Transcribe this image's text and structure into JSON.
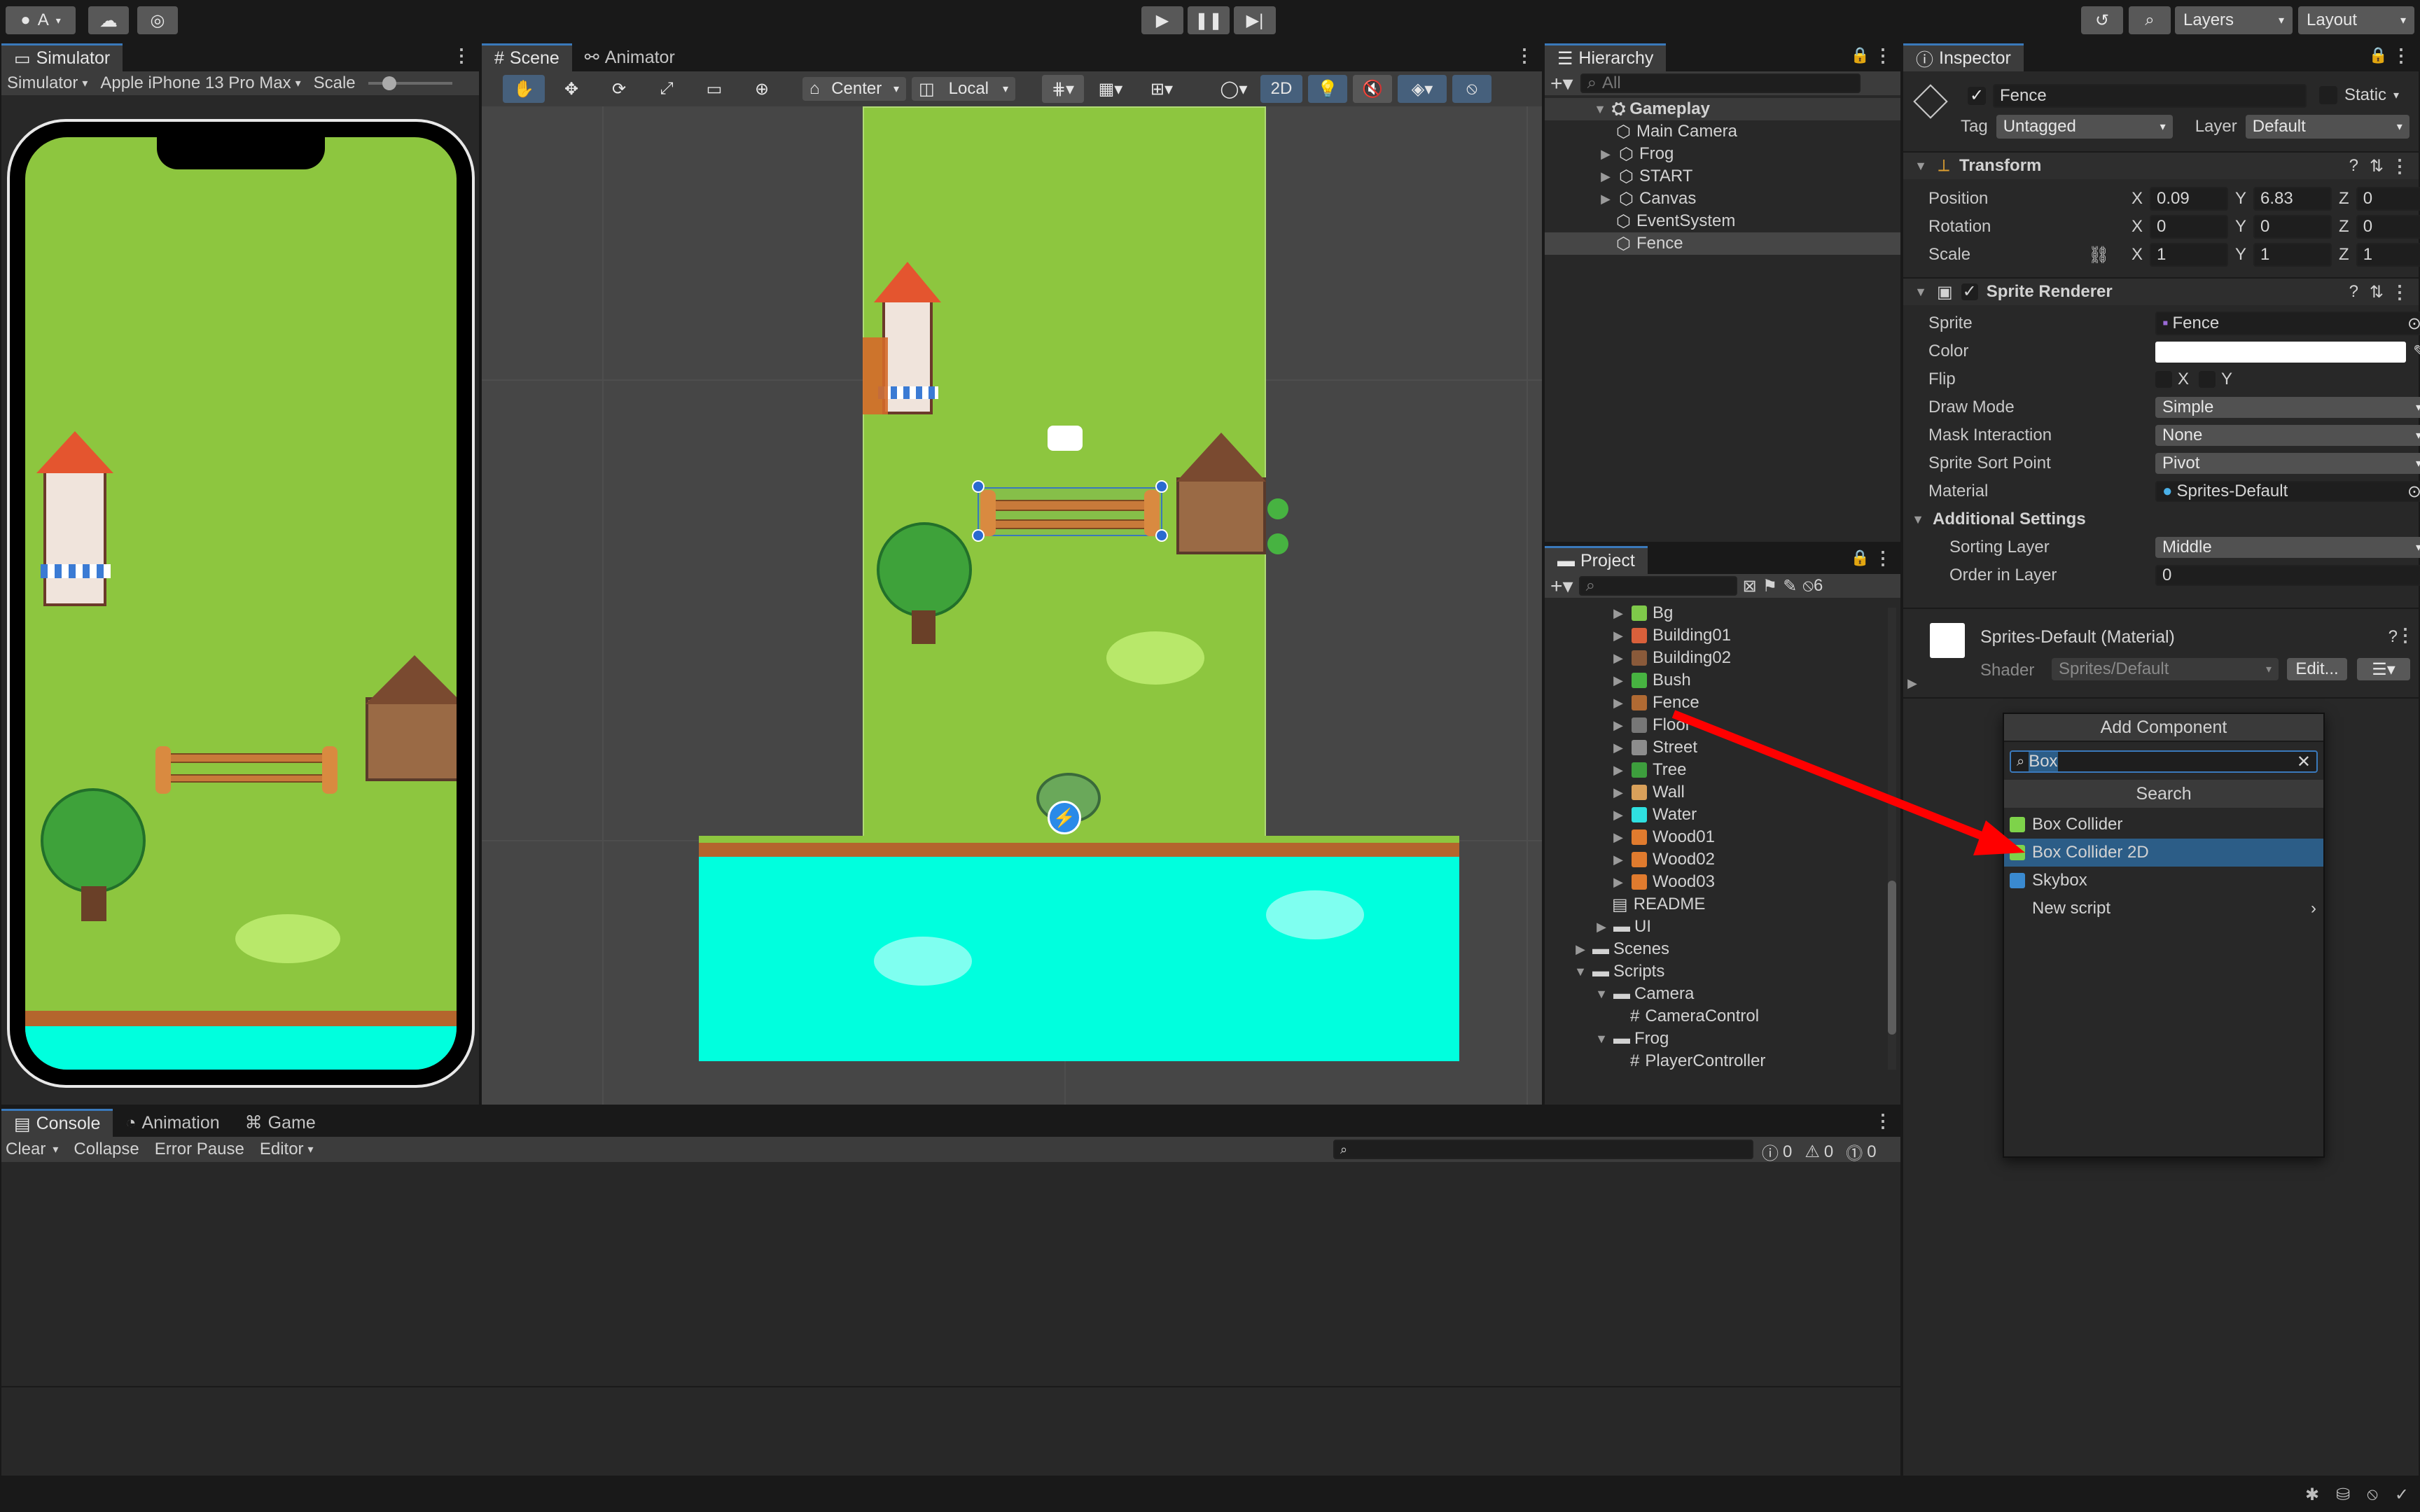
{
  "toolbar": {
    "account": "A",
    "layers": "Layers",
    "layout": "Layout"
  },
  "simulator": {
    "tab": "Simulator",
    "mode": "Simulator",
    "device": "Apple iPhone 13 Pro Max",
    "scale_label": "Scale"
  },
  "scene": {
    "tab_scene": "Scene",
    "tab_animator": "Animator",
    "pivot": "Center",
    "space": "Local",
    "mode_2d": "2D"
  },
  "hierarchy": {
    "tab": "Hierarchy",
    "search_placeholder": "All",
    "root": "Gameplay",
    "items": [
      "Main Camera",
      "Frog",
      "START",
      "Canvas",
      "EventSystem",
      "Fence"
    ]
  },
  "project": {
    "tab": "Project",
    "hidden_count": "6",
    "items": [
      {
        "label": "Bg",
        "color": "#7fc94a"
      },
      {
        "label": "Building01",
        "color": "#d9603b"
      },
      {
        "label": "Building02",
        "color": "#8a5a3a"
      },
      {
        "label": "Bush",
        "color": "#47b341"
      },
      {
        "label": "Fence",
        "color": "#b06a33"
      },
      {
        "label": "Floor",
        "color": "#777777"
      },
      {
        "label": "Street",
        "color": "#8d8d8d"
      },
      {
        "label": "Tree",
        "color": "#3d9e3d"
      },
      {
        "label": "Wall",
        "color": "#d9a05a"
      },
      {
        "label": "Water",
        "color": "#2fe0e0"
      },
      {
        "label": "Wood01",
        "color": "#e07b2e"
      },
      {
        "label": "Wood02",
        "color": "#e07b2e"
      },
      {
        "label": "Wood03",
        "color": "#e07b2e"
      }
    ],
    "readme": "README",
    "ui": "UI",
    "scenes": "Scenes",
    "scripts": "Scripts",
    "camera": "Camera",
    "camera_control": "CameraControl",
    "frog": "Frog",
    "player_controller": "PlayerController"
  },
  "inspector": {
    "tab": "Inspector",
    "object_name": "Fence",
    "static": "Static",
    "tag_label": "Tag",
    "tag_value": "Untagged",
    "layer_label": "Layer",
    "layer_value": "Default",
    "transform": {
      "title": "Transform",
      "position": "Position",
      "rotation": "Rotation",
      "scale": "Scale",
      "pos": {
        "x": "0.09",
        "y": "6.83",
        "z": "0"
      },
      "rot": {
        "x": "0",
        "y": "0",
        "z": "0"
      },
      "scl": {
        "x": "1",
        "y": "1",
        "z": "1"
      }
    },
    "sprite_renderer": {
      "title": "Sprite Renderer",
      "sprite": "Sprite",
      "sprite_value": "Fence",
      "color": "Color",
      "flip": "Flip",
      "draw_mode": "Draw Mode",
      "draw_mode_value": "Simple",
      "mask": "Mask Interaction",
      "mask_value": "None",
      "sort_point": "Sprite Sort Point",
      "sort_point_value": "Pivot",
      "material": "Material",
      "material_value": "Sprites-Default",
      "additional": "Additional Settings",
      "sorting_layer": "Sorting Layer",
      "sorting_layer_value": "Middle",
      "order": "Order in Layer",
      "order_value": "0"
    },
    "material_section": {
      "title": "Sprites-Default (Material)",
      "shader": "Shader",
      "shader_value": "Sprites/Default",
      "edit": "Edit..."
    }
  },
  "add_component": {
    "title": "Add Component",
    "search_value": "Box",
    "section": "Search",
    "items": [
      "Box Collider",
      "Box Collider 2D",
      "Skybox",
      "New script"
    ],
    "selected": "Box Collider 2D"
  },
  "console": {
    "tab_console": "Console",
    "tab_animation": "Animation",
    "tab_game": "Game",
    "clear": "Clear",
    "collapse": "Collapse",
    "error_pause": "Error Pause",
    "editor": "Editor",
    "count_info": "0",
    "count_warn": "0",
    "count_error": "0"
  },
  "axes": {
    "x": "X",
    "y": "Y",
    "z": "Z"
  },
  "colors": {
    "accent": "#3a79bb",
    "selection": "#2c5d87",
    "grass": "#8dc63f",
    "water": "#00ffde",
    "arrow": "#ff0000"
  }
}
